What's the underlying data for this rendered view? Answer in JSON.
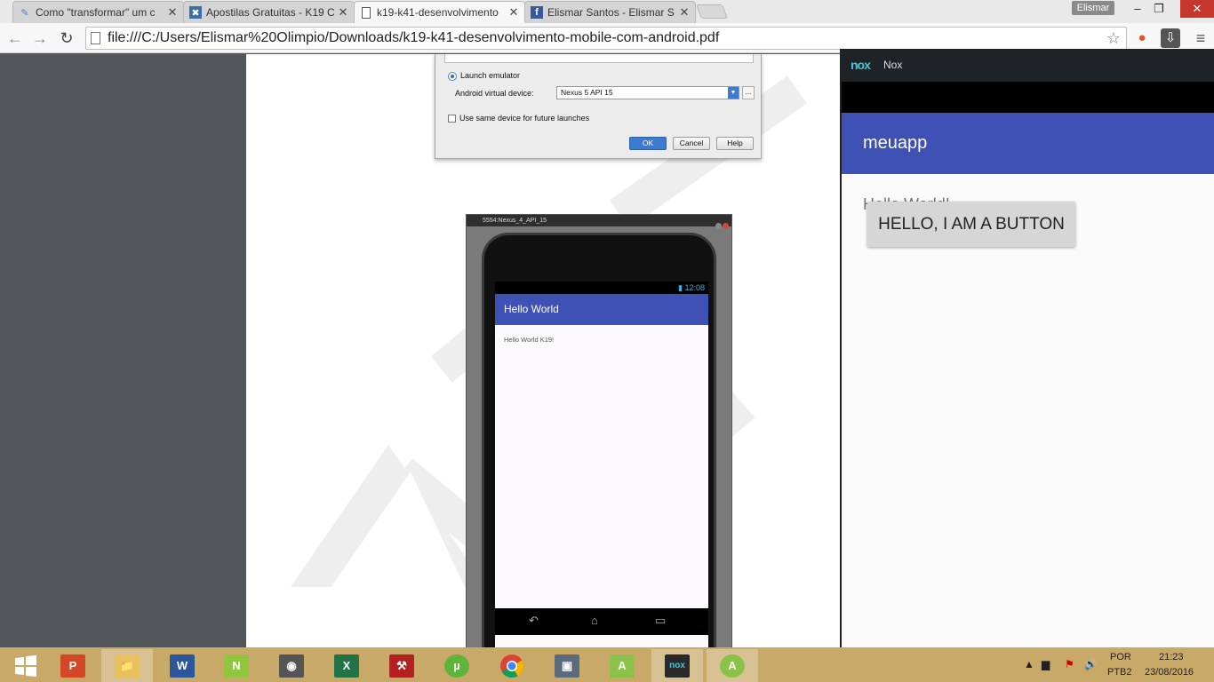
{
  "browser": {
    "tabs": [
      {
        "title": "Como \"transformar\" um c",
        "icon": "android-studio-icon"
      },
      {
        "title": "Apostilas Gratuitas - K19 C",
        "icon": "k19-icon"
      },
      {
        "title": "k19-k41-desenvolvimento",
        "icon": "page-icon"
      },
      {
        "title": "Elismar Santos - Elismar S",
        "icon": "facebook-icon"
      }
    ],
    "user": "Elismar",
    "url": "file:///C:/Users/Elismar%20Olimpio/Downloads/k19-k41-desenvolvimento-mobile-com-android.pdf"
  },
  "dialog": {
    "launch_label": "Launch emulator",
    "avd_label": "Android virtual device:",
    "avd_value": "Nexus 5 API 15",
    "more": "...",
    "same_device_label": "Use same device for future launches",
    "ok": "OK",
    "cancel": "Cancel",
    "help": "Help"
  },
  "emulator": {
    "title": "5554:Nexus_4_API_15",
    "time": "12:08",
    "app_title": "Hello World",
    "body_text": "Hello World K19!"
  },
  "nox": {
    "logo": "nox",
    "title": "Nox",
    "app_title": "meuapp",
    "hello_text": "Hello World!",
    "button_label": "HELLO, I AM A BUTTON"
  },
  "taskbar": {
    "apps": [
      "start",
      "powerpoint",
      "file-explorer",
      "word",
      "notepad-plus-plus",
      "movie-maker",
      "excel",
      "tool",
      "utorrent",
      "chrome",
      "computer",
      "android-studio",
      "nox",
      "android-studio-2"
    ],
    "lang1": "POR",
    "lang2": "PTB2",
    "time": "21:23",
    "date": "23/08/2016"
  },
  "colors": {
    "accent": "#3f51b5",
    "taskbar": "#c9a968",
    "nox_logo": "#44c6d8"
  }
}
